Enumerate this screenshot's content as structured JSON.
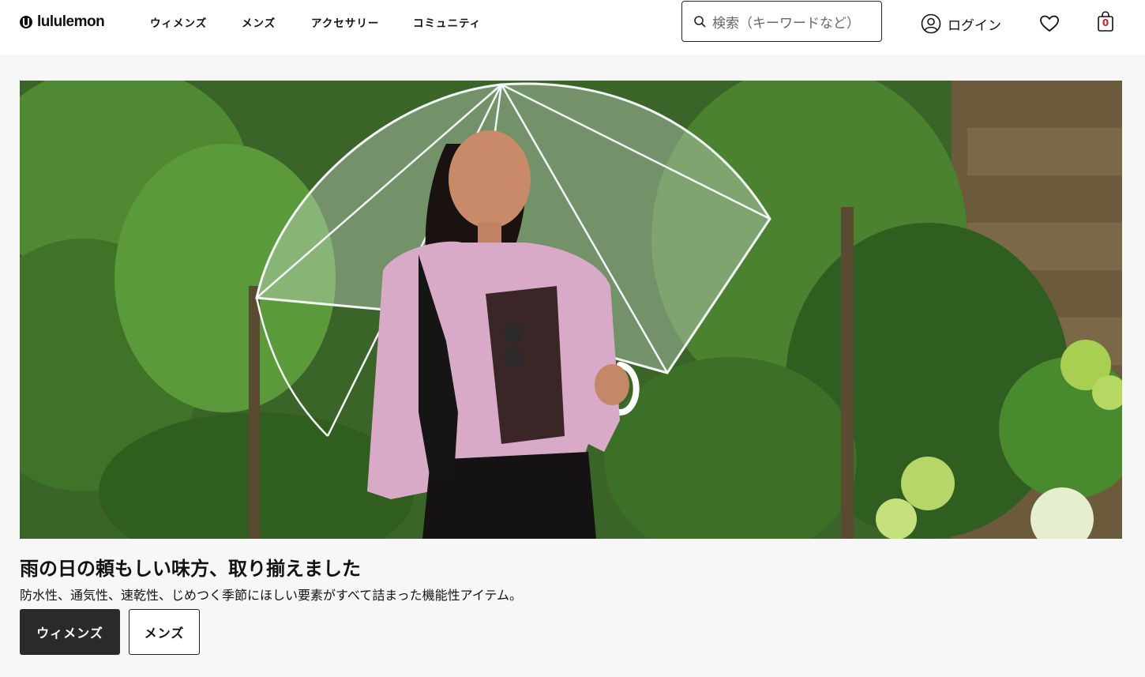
{
  "brand": {
    "name": "lululemon"
  },
  "nav": {
    "items": [
      {
        "label": "ウィメンズ"
      },
      {
        "label": "メンズ"
      },
      {
        "label": "アクセサリー"
      },
      {
        "label": "コミュニティ"
      }
    ]
  },
  "search": {
    "placeholder": "検索（キーワードなど）"
  },
  "account": {
    "login_label": "ログイン"
  },
  "cart": {
    "count": "0"
  },
  "hero": {
    "headline": "雨の日の頼もしい味方、取り揃えました",
    "subcopy": "防水性、通気性、速乾性、じめつく季節にほしい要素がすべて詰まった機能性アイテム。",
    "buttons": [
      {
        "label": "ウィメンズ"
      },
      {
        "label": "メンズ"
      }
    ]
  },
  "colors": {
    "accent_dark": "#2a2a2a",
    "cart_count": "#d22030",
    "background": "#f7f7f7"
  }
}
